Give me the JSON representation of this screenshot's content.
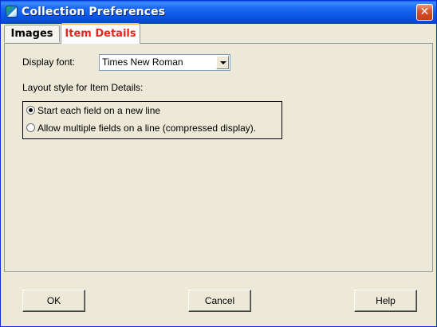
{
  "window": {
    "title": "Collection Preferences",
    "close_symbol": "✕"
  },
  "tabs": [
    {
      "label": "Images",
      "active": false
    },
    {
      "label": "Item Details",
      "active": true
    }
  ],
  "display_font": {
    "label": "Display font:",
    "value": "Times New Roman"
  },
  "layout": {
    "label": "Layout style for Item Details:",
    "options": [
      {
        "label": "Start each field on a new line",
        "checked": true
      },
      {
        "label": "Allow multiple fields on a line (compressed display).",
        "checked": false
      }
    ]
  },
  "buttons": {
    "ok": "OK",
    "cancel": "Cancel",
    "help": "Help"
  },
  "colors": {
    "active_tab_text": "#E4271C",
    "title_bar": "#0A54E3",
    "background": "#ECE9D8"
  }
}
